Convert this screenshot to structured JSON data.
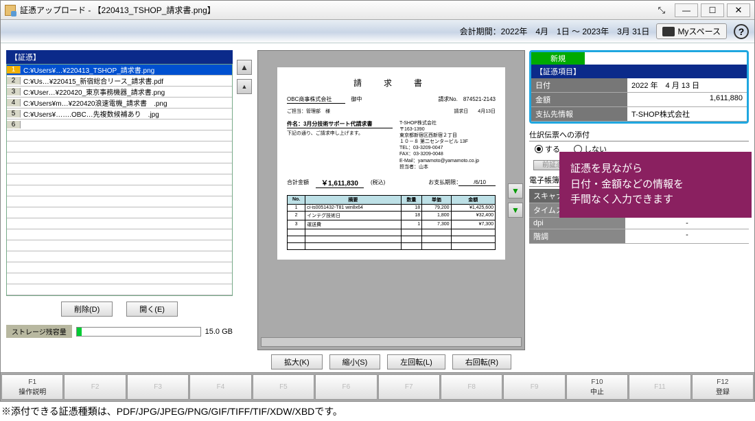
{
  "window": {
    "title": "証憑アップロード - 【220413_TSHOP_請求書.png】"
  },
  "header": {
    "period": "会計期間：2022年　4月　1日 ～ 2023年　3月 31日",
    "myspace": "Myスペース"
  },
  "file_list": {
    "header": "【証憑】",
    "items": [
      {
        "n": "1",
        "path": "C:¥Users¥…¥220413_TSHOP_請求書.png"
      },
      {
        "n": "2",
        "path": "C:¥Us…¥220415_新宿総合リース_請求書.pdf"
      },
      {
        "n": "3",
        "path": "C:¥User…¥220420_東京事務機器_請求書.png"
      },
      {
        "n": "4",
        "path": "C:¥Users¥m…¥220420浪速電機_請求書　.png"
      },
      {
        "n": "5",
        "path": "C:¥Users¥…….OBC…先複数候補あり　.jpg"
      },
      {
        "n": "6",
        "path": ""
      }
    ],
    "delete_btn": "削除(D)",
    "open_btn": "開く(E)"
  },
  "storage": {
    "label": "ストレージ残容量",
    "value": "15.0 GB"
  },
  "preview": {
    "doc_title": "請　求　書",
    "company": "OBC商事株式会社",
    "onchu": "御中",
    "inv_no_label": "請求No.",
    "inv_no": "874521-2143",
    "contact_label": "ご担当：管理部　様",
    "inv_date_label": "請求日",
    "inv_date": "　4月13日",
    "subject_label": "件名：3月分技術サポート代請求書",
    "subject_note": "下記の通り、ご請求申し上げます。",
    "supplier": "T-SHOP株式会社",
    "zip": "〒163-1390",
    "addr1": "東京都新宿区西新宿２丁目",
    "addr2": "１０－８ 第二センタービル 13F",
    "tel": "TEL：03-3209-0047",
    "fax": "FAX：03-3209-0048",
    "email": "E-Mail：yamamoto@yamamoto.co.jp",
    "person": "担当者：山本",
    "total_label": "合計金額",
    "total": "￥1,611,830",
    "tax_note": "(税込)",
    "paydate_label": "お支払期限：",
    "paydate": "　/6/10",
    "tbl": {
      "h": [
        "No.",
        "摘要",
        "数量",
        "単価",
        "金額"
      ],
      "rows": [
        [
          "1",
          "ci-is0051432-T81 win8x64",
          "18",
          "79,200",
          "¥1,425,600"
        ],
        [
          "2",
          "インテグ技術日",
          "18",
          "1,800",
          "¥32,400"
        ],
        [
          "3",
          "運送費",
          "1",
          "7,300",
          "¥7,300"
        ]
      ]
    },
    "btns": {
      "zoom_in": "拡大(K)",
      "zoom_out": "縮小(S)",
      "rot_l": "左回転(L)",
      "rot_r": "右回転(R)"
    }
  },
  "fields": {
    "new": "新規",
    "header": "【証憑項目】",
    "date_label": "日付",
    "date_val": "2022 年　4 月 13 日",
    "amount_label": "金額",
    "amount_val": "1,611,880",
    "payee_label": "支払先情報",
    "payee_val": "T-SHOP株式会社"
  },
  "attach": {
    "title": "仕訳伝票への添付",
    "yes": "する",
    "no": "しない"
  },
  "prev_voucher_btn": "前証憑（P）",
  "ebook": {
    "title": "電子帳簿保",
    "rows": [
      {
        "label": "スキャナ保",
        "val": ""
      },
      {
        "label": "タイムスタ",
        "val": "-"
      },
      {
        "label": "dpi",
        "val": "-"
      },
      {
        "label": "階調",
        "val": "-"
      }
    ]
  },
  "callout": {
    "l1": "証憑を見ながら",
    "l2": "日付・金額などの情報を",
    "l3": "手間なく入力できます"
  },
  "fkeys": [
    {
      "f": "F1",
      "label": "操作説明",
      "dim": false
    },
    {
      "f": "F2",
      "label": "",
      "dim": true
    },
    {
      "f": "F3",
      "label": "",
      "dim": true
    },
    {
      "f": "F4",
      "label": "",
      "dim": true
    },
    {
      "f": "F5",
      "label": "",
      "dim": true
    },
    {
      "f": "F6",
      "label": "",
      "dim": true
    },
    {
      "f": "F7",
      "label": "",
      "dim": true
    },
    {
      "f": "F8",
      "label": "",
      "dim": true
    },
    {
      "f": "F9",
      "label": "",
      "dim": true
    },
    {
      "f": "F10",
      "label": "中止",
      "dim": false
    },
    {
      "f": "F11",
      "label": "",
      "dim": true
    },
    {
      "f": "F12",
      "label": "登録",
      "dim": false
    }
  ],
  "footnote": "※添付できる証憑種類は、PDF/JPG/JPEG/PNG/GIF/TIFF/TIF/XDW/XBDです。"
}
